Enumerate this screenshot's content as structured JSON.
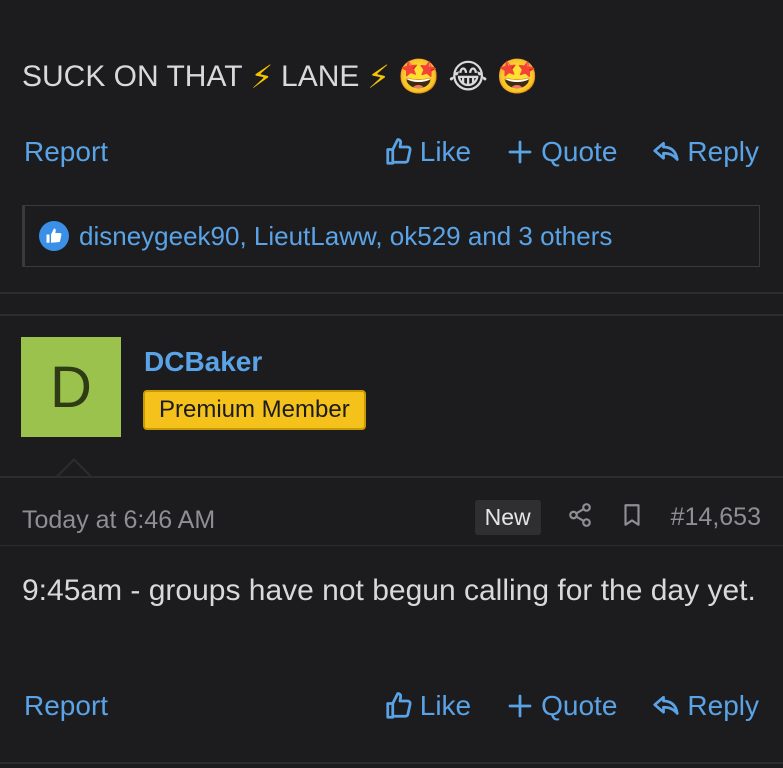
{
  "post1": {
    "message_text": "SUCK ON THAT",
    "message_text2": "LANE",
    "emojis": [
      "🤩",
      "😂",
      "🤩"
    ],
    "actions": {
      "report": "Report",
      "like": "Like",
      "quote": "Quote",
      "reply": "Reply"
    },
    "likes_summary": "disneygeek90, LieutLaww, ok529 and 3 others"
  },
  "post2": {
    "avatar_letter": "D",
    "username": "DCBaker",
    "rank": "Premium Member",
    "timestamp": "Today at 6:46 AM",
    "new_badge": "New",
    "post_number": "#14,653",
    "message": "9:45am - groups have not begun calling for the day yet.",
    "actions": {
      "report": "Report",
      "like": "Like",
      "quote": "Quote",
      "reply": "Reply"
    }
  },
  "colors": {
    "link": "#5aa3e6",
    "rank_bg": "#f5c21b",
    "avatar_bg": "#9cc24e",
    "background": "#1c1c1e"
  }
}
